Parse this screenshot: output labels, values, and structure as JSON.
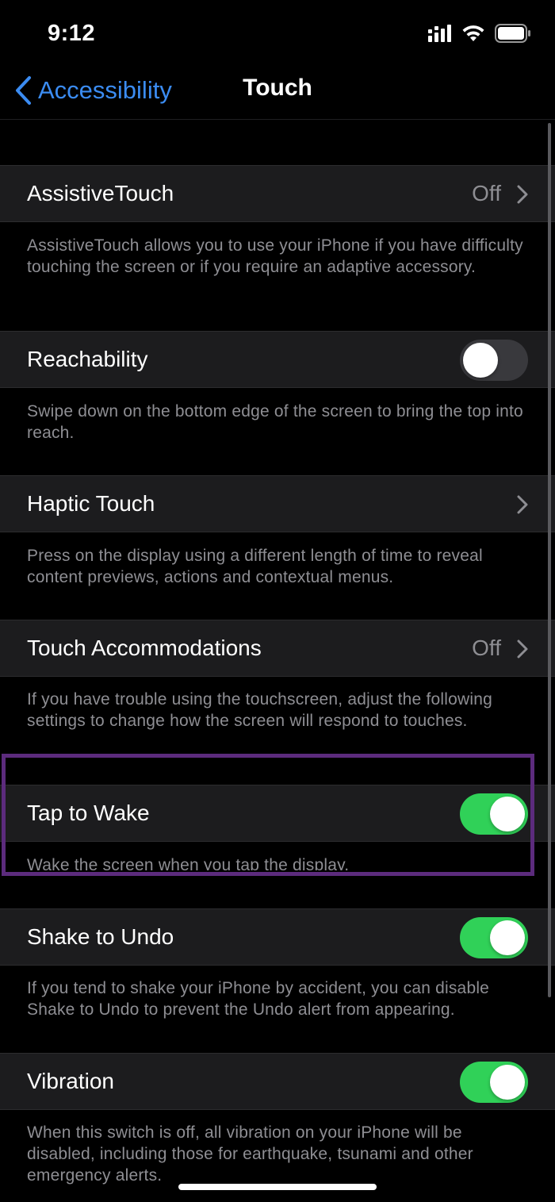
{
  "status_bar": {
    "time": "9:12"
  },
  "nav": {
    "back_label": "Accessibility",
    "title": "Touch"
  },
  "settings": [
    {
      "label": "AssistiveTouch",
      "value": "Off",
      "description": "AssistiveTouch allows you to use your iPhone if you have difficulty touching the screen or if you require an adaptive accessory."
    },
    {
      "label": "Reachability",
      "toggle": false,
      "description": "Swipe down on the bottom edge of the screen to bring the top into reach."
    },
    {
      "label": "Haptic Touch",
      "description": "Press on the display using a different length of time to reveal content previews, actions and contextual menus."
    },
    {
      "label": "Touch Accommodations",
      "value": "Off",
      "description": "If you have trouble using the touchscreen, adjust the following settings to change how the screen will respond to touches."
    },
    {
      "label": "Tap to Wake",
      "toggle": true,
      "description": "Wake the screen when you tap the display."
    },
    {
      "label": "Shake to Undo",
      "toggle": true,
      "description": "If you tend to shake your iPhone by accident, you can disable Shake to Undo to prevent the Undo alert from appearing."
    },
    {
      "label": "Vibration",
      "toggle": true,
      "description": "When this switch is off, all vibration on your iPhone will be disabled, including those for earthquake, tsunami and other emergency alerts."
    }
  ],
  "colors": {
    "background": "#000000",
    "cell": "#1c1c1e",
    "accent_blue": "#3b8cf2",
    "toggle_on": "#30d158",
    "toggle_off": "#39393d",
    "secondary_text": "#8e8e93",
    "highlight_purple": "#5c2b7d"
  },
  "icons": [
    "signal-icon",
    "wifi-icon",
    "battery-icon",
    "back-chevron-icon",
    "chevron-right-icon"
  ]
}
